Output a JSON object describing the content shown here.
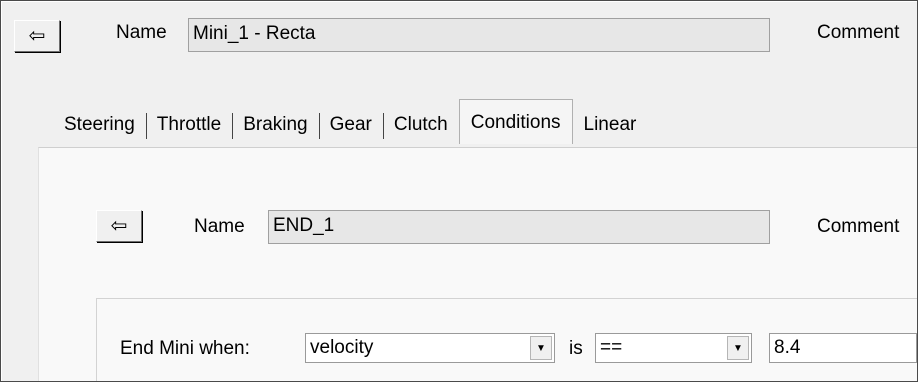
{
  "top": {
    "back_glyph": "⇦",
    "name_label": "Name",
    "name_value": "Mini_1 - Recta",
    "comment_label": "Comment"
  },
  "tabs": [
    {
      "label": "Steering"
    },
    {
      "label": "Throttle"
    },
    {
      "label": "Braking"
    },
    {
      "label": "Gear"
    },
    {
      "label": "Clutch"
    },
    {
      "label": "Conditions",
      "active": true
    },
    {
      "label": "Linear"
    }
  ],
  "inner": {
    "back_glyph": "⇦",
    "name_label": "Name",
    "name_value": "END_1",
    "comment_label": "Comment"
  },
  "condition": {
    "end_label": "End Mini when:",
    "variable": "velocity",
    "is_label": "is",
    "operator": "==",
    "value": "8.4",
    "dropdown_glyph": "▼"
  }
}
